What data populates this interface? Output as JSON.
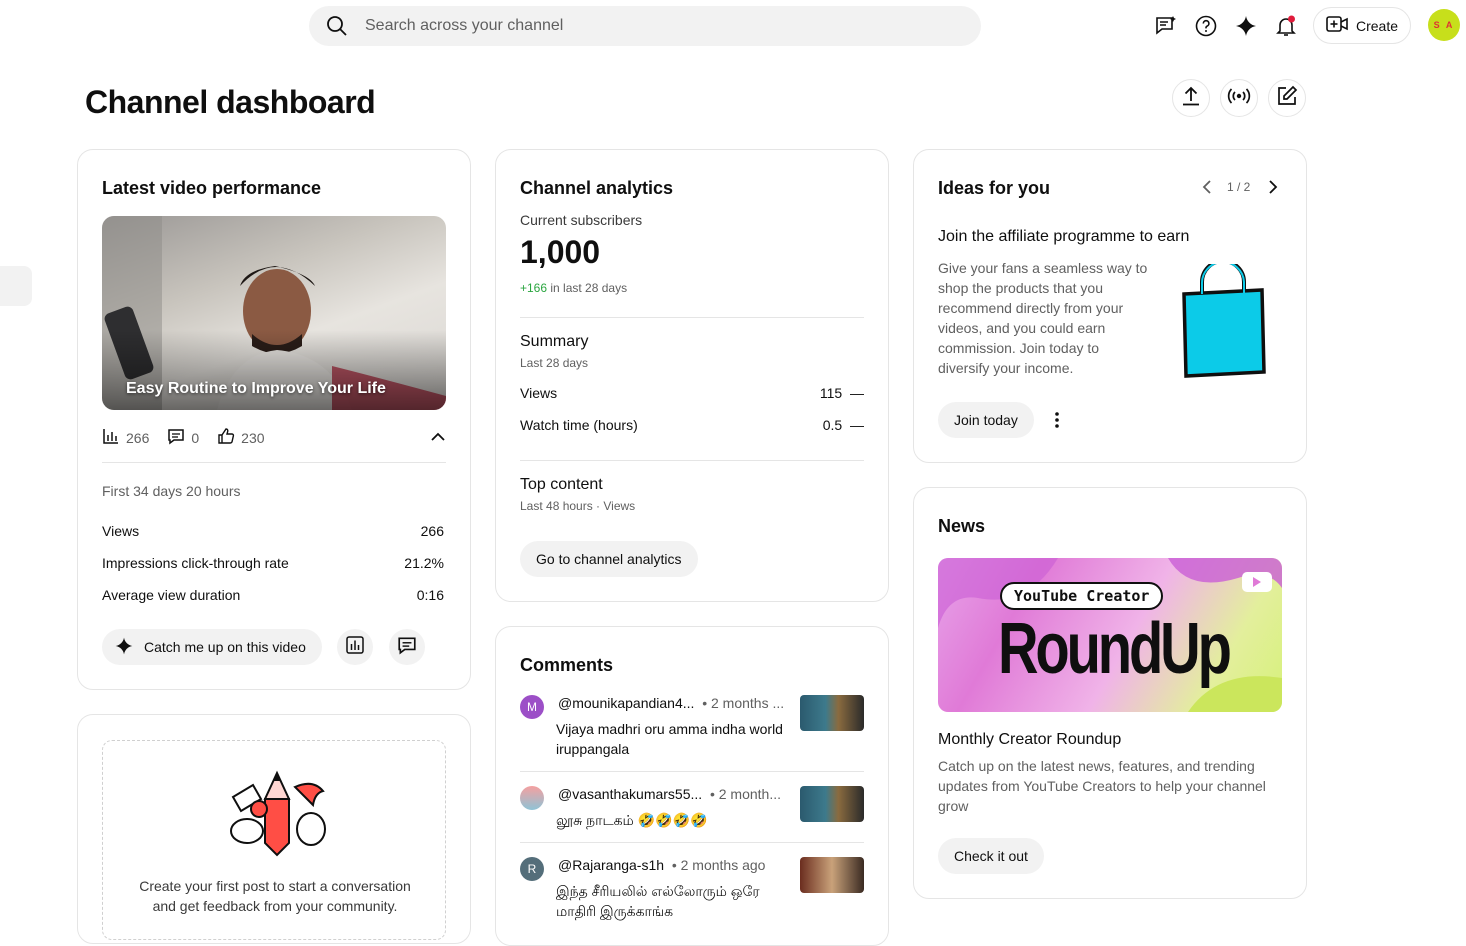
{
  "search": {
    "placeholder": "Search across your channel"
  },
  "header": {
    "create_label": "Create",
    "avatar_initials": "S A"
  },
  "page": {
    "title": "Channel dashboard"
  },
  "latest_video": {
    "card_title": "Latest video performance",
    "video_title": "Easy Routine to Improve Your Life",
    "views": "266",
    "comments": "0",
    "likes": "230",
    "period": "First 34 days 20 hours",
    "metrics": [
      {
        "label": "Views",
        "value": "266"
      },
      {
        "label": "Impressions click-through rate",
        "value": "21.2%"
      },
      {
        "label": "Average view duration",
        "value": "0:16"
      }
    ],
    "catch_up_label": "Catch me up on this video"
  },
  "post_card": {
    "text": "Create your first post to start a conversation and get feedback from your community."
  },
  "analytics": {
    "card_title": "Channel analytics",
    "subs_label": "Current subscribers",
    "subs_value": "1,000",
    "subs_change": "+166",
    "subs_change_suffix": "in last 28 days",
    "summary_title": "Summary",
    "summary_period": "Last 28 days",
    "summary_rows": [
      {
        "label": "Views",
        "value": "115",
        "trend": "—"
      },
      {
        "label": "Watch time (hours)",
        "value": "0.5",
        "trend": "—"
      }
    ],
    "top_content_title": "Top content",
    "top_content_period": "Last 48 hours · Views",
    "button_label": "Go to channel analytics"
  },
  "comments": {
    "card_title": "Comments",
    "items": [
      {
        "initial": "M",
        "color": "#9c4fc7",
        "user": "@mounikapandian4...",
        "time": "• 2 months ...",
        "text": "Vijaya madhri oru amma indha world iruppangala"
      },
      {
        "initial": "",
        "color": "#8fc3d6",
        "user": "@vasanthakumars55...",
        "time": "• 2 month...",
        "text": "லூசு நாடகம் 🤣🤣🤣🤣"
      },
      {
        "initial": "R",
        "color": "#546e7a",
        "user": "@Rajaranga-s1h",
        "time": "• 2 months ago",
        "text": "இந்த சீரியலில் எல்லோரும் ஒரே மாதிரி இருக்காங்க"
      }
    ]
  },
  "ideas": {
    "card_title": "Ideas for you",
    "pager": "1 / 2",
    "idea_title": "Join the affiliate programme to earn",
    "idea_text": "Give your fans a seamless way to shop the products that you recommend directly from your videos, and you could earn commission. Join today to diversify your income.",
    "button_label": "Join today"
  },
  "news": {
    "card_title": "News",
    "banner_small": "YouTube Creator",
    "banner_big": "RoundUp",
    "item_title": "Monthly Creator Roundup",
    "item_text": "Catch up on the latest news, features, and trending updates from YouTube Creators to help your channel grow",
    "button_label": "Check it out"
  },
  "colors": {
    "positive": "#2ba640",
    "bag": "#0ccbe8",
    "bell_dot": "#e01b3b"
  }
}
